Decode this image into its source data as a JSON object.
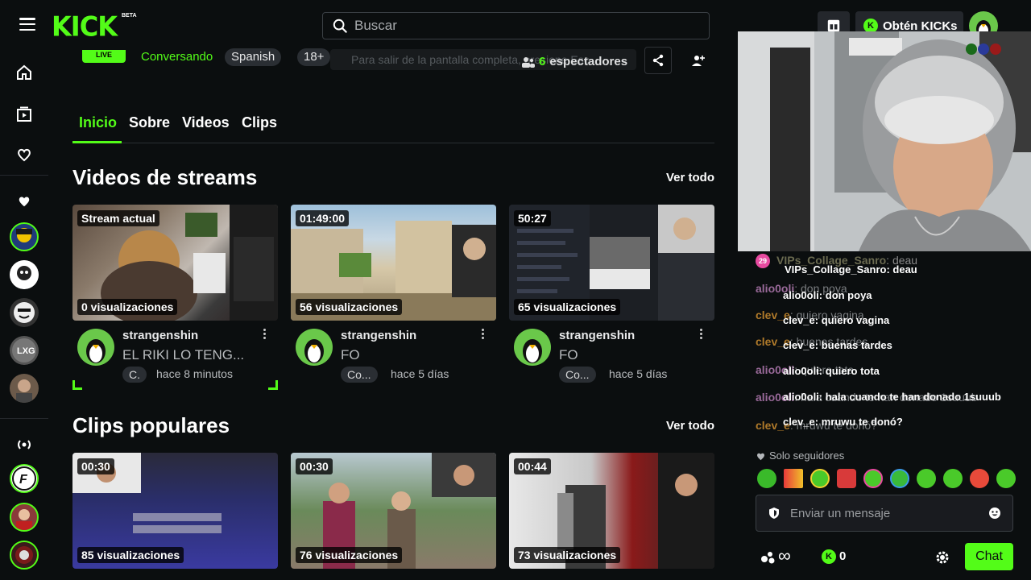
{
  "header": {
    "logo": "KICK",
    "beta": "BETA",
    "search_placeholder": "Buscar",
    "kicks_button": "Obtén KICKs"
  },
  "stream": {
    "live": "LIVE",
    "category": "Conversando",
    "tags": [
      "Spanish",
      "18+"
    ],
    "fullscreen_hint": "Para salir de la pantalla completa, presione Esc",
    "viewers_count": "6",
    "viewers_label": "espectadores"
  },
  "tabs": [
    {
      "label": "Inicio",
      "active": true
    },
    {
      "label": "Sobre"
    },
    {
      "label": "Videos"
    },
    {
      "label": "Clips"
    }
  ],
  "sections": {
    "streams_title": "Videos de streams",
    "clips_title": "Clips populares",
    "see_all": "Ver todo"
  },
  "stream_videos": [
    {
      "badge": "Stream actual",
      "views": "0 visualizaciones",
      "channel": "strangenshin",
      "title": "EL RIKI LO TENG...",
      "category": "C.",
      "time": "hace 8 minutos"
    },
    {
      "badge": "01:49:00",
      "views": "56 visualizaciones",
      "channel": "strangenshin",
      "title": "FO",
      "category": "Co...",
      "time": "hace 5 días"
    },
    {
      "badge": "50:27",
      "views": "65 visualizaciones",
      "channel": "strangenshin",
      "title": "FO",
      "category": "Co...",
      "time": "hace 5 días"
    }
  ],
  "clips": [
    {
      "badge": "00:30",
      "views": "85 visualizaciones"
    },
    {
      "badge": "00:30",
      "views": "76 visualizaciones"
    },
    {
      "badge": "00:44",
      "views": "73 visualizaciones"
    }
  ],
  "chat": {
    "messages": [
      {
        "user": "VIPs_Collage_Sanro",
        "text": "deau"
      },
      {
        "user": "alio0oli",
        "text": "don poya"
      },
      {
        "user": "clev_e",
        "text": "quiero vagina"
      },
      {
        "user": "clev_e",
        "text": "buenas tardes"
      },
      {
        "user": "alio0oli",
        "text": "quiero tota"
      },
      {
        "user": "alio0oli",
        "text": "hala cuando te han donado 1suuub"
      },
      {
        "user": "clev_e",
        "text": "mruwu te donó?"
      }
    ],
    "badge_number": "29",
    "followers_only": "Solo seguidores",
    "input_placeholder": "Enviar un mensaje",
    "infinity": "∞",
    "kicks_count": "0",
    "send_button": "Chat"
  },
  "colors": {
    "brand_green": "#53fc18",
    "background": "#0b0e0f",
    "surface": "#24272c"
  }
}
